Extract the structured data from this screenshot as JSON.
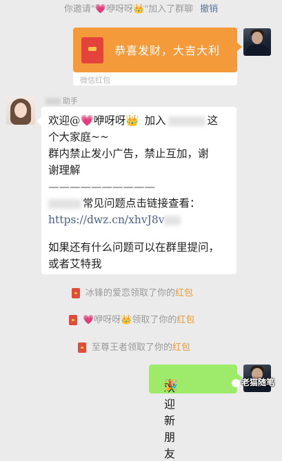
{
  "system_top": {
    "pre": "你邀请\"",
    "heart": "💗",
    "name": "咿呀呀",
    "crown": "👑",
    "post": "\"加入了群聊",
    "revoke": "撤销"
  },
  "red_packet": {
    "greeting": "恭喜发财，大吉大利",
    "footer": "微信红包"
  },
  "sender": {
    "suffix": "助手"
  },
  "message": {
    "l1_pre": "欢迎@",
    "l1_heart": "💗",
    "l1_name": "咿呀呀",
    "l1_crown": "👑",
    "l1_post": "加入",
    "l1_end": "这",
    "l2": "个大家庭~~",
    "l3": "群内禁止发小广告，禁止互加，谢",
    "l4": "谢理解",
    "divider": "——————————",
    "l6": "常见问题点击链接查看：",
    "link": "https://dwz.cn/xhvJ8v",
    "l8": "如果还有什么问题可以在群里提问，",
    "l9": "或者艾特我"
  },
  "notices": [
    {
      "pre": "冰锋的爱恋领取了你的",
      "hl": "红包"
    },
    {
      "heart": "💗",
      "name": "咿呀呀",
      "crown": "👑",
      "pre": "领取了你的",
      "hl": "红包"
    },
    {
      "pre": "至尊王者领取了你的",
      "hl": "红包"
    }
  ],
  "welcome": {
    "text": "欢迎新朋友",
    "emoji": "🎉"
  },
  "watermark": {
    "text": "老猫随笔"
  },
  "colors": {
    "bg": "#ebebeb",
    "red_packet": "#f59a3b",
    "green_bubble": "#9eea6a",
    "link": "#4d5f89",
    "highlight": "#e89a3c"
  }
}
